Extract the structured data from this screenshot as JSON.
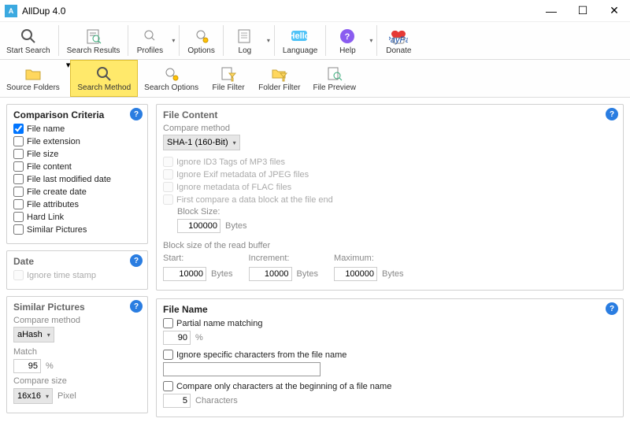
{
  "window": {
    "title": "AllDup 4.0"
  },
  "toolbar": {
    "start_search": "Start Search",
    "search_results": "Search Results",
    "profiles": "Profiles",
    "options": "Options",
    "log": "Log",
    "language": "Language",
    "help": "Help",
    "donate": "Donate"
  },
  "tabs": {
    "source_folders": "Source Folders",
    "search_method": "Search Method",
    "search_options": "Search Options",
    "file_filter": "File Filter",
    "folder_filter": "Folder Filter",
    "file_preview": "File Preview"
  },
  "criteria": {
    "title": "Comparison Criteria",
    "file_name": "File name",
    "file_extension": "File extension",
    "file_size": "File size",
    "file_content": "File content",
    "file_modified": "File last modified date",
    "file_create": "File create date",
    "file_attributes": "File attributes",
    "hard_link": "Hard Link",
    "similar_pictures": "Similar Pictures"
  },
  "date": {
    "title": "Date",
    "ignore_ts": "Ignore time stamp"
  },
  "simpics": {
    "title": "Similar Pictures",
    "compare_method_label": "Compare method",
    "compare_method": "aHash",
    "match_label": "Match",
    "match_value": "95",
    "match_unit": "%",
    "compare_size_label": "Compare size",
    "compare_size": "16x16",
    "compare_size_unit": "Pixel"
  },
  "filecontent": {
    "title": "File Content",
    "compare_method_label": "Compare method",
    "compare_method": "SHA-1 (160-Bit)",
    "ignore_id3": "Ignore ID3 Tags of MP3 files",
    "ignore_exif": "Ignore Exif metadata of JPEG files",
    "ignore_flac": "Ignore metadata of FLAC files",
    "first_compare": "First compare a data block at the file end",
    "block_size_label": "Block Size:",
    "block_size": "100000",
    "bytes": "Bytes",
    "buffer_label": "Block size of the read buffer",
    "start_label": "Start:",
    "start": "10000",
    "inc_label": "Increment:",
    "inc": "10000",
    "max_label": "Maximum:",
    "max": "100000"
  },
  "filename": {
    "title": "File Name",
    "partial": "Partial name matching",
    "partial_value": "90",
    "partial_unit": "%",
    "ignore_chars": "Ignore specific characters from the file name",
    "compare_begin": "Compare only characters at the beginning of a file name",
    "begin_value": "5",
    "begin_unit": "Characters"
  }
}
